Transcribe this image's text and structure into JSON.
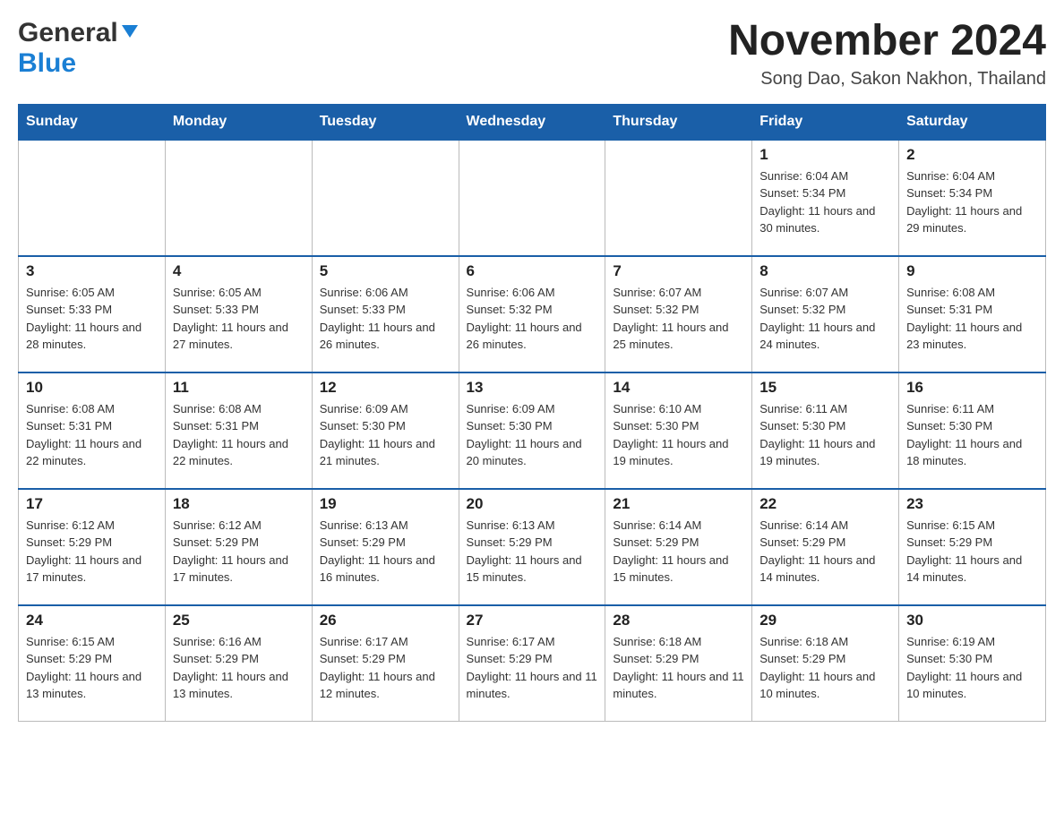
{
  "header": {
    "logo": {
      "general": "General",
      "blue": "Blue",
      "arrow": "▶"
    },
    "title": "November 2024",
    "subtitle": "Song Dao, Sakon Nakhon, Thailand"
  },
  "days_of_week": [
    "Sunday",
    "Monday",
    "Tuesday",
    "Wednesday",
    "Thursday",
    "Friday",
    "Saturday"
  ],
  "weeks": [
    [
      {
        "day": "",
        "info": ""
      },
      {
        "day": "",
        "info": ""
      },
      {
        "day": "",
        "info": ""
      },
      {
        "day": "",
        "info": ""
      },
      {
        "day": "",
        "info": ""
      },
      {
        "day": "1",
        "info": "Sunrise: 6:04 AM\nSunset: 5:34 PM\nDaylight: 11 hours and 30 minutes."
      },
      {
        "day": "2",
        "info": "Sunrise: 6:04 AM\nSunset: 5:34 PM\nDaylight: 11 hours and 29 minutes."
      }
    ],
    [
      {
        "day": "3",
        "info": "Sunrise: 6:05 AM\nSunset: 5:33 PM\nDaylight: 11 hours and 28 minutes."
      },
      {
        "day": "4",
        "info": "Sunrise: 6:05 AM\nSunset: 5:33 PM\nDaylight: 11 hours and 27 minutes."
      },
      {
        "day": "5",
        "info": "Sunrise: 6:06 AM\nSunset: 5:33 PM\nDaylight: 11 hours and 26 minutes."
      },
      {
        "day": "6",
        "info": "Sunrise: 6:06 AM\nSunset: 5:32 PM\nDaylight: 11 hours and 26 minutes."
      },
      {
        "day": "7",
        "info": "Sunrise: 6:07 AM\nSunset: 5:32 PM\nDaylight: 11 hours and 25 minutes."
      },
      {
        "day": "8",
        "info": "Sunrise: 6:07 AM\nSunset: 5:32 PM\nDaylight: 11 hours and 24 minutes."
      },
      {
        "day": "9",
        "info": "Sunrise: 6:08 AM\nSunset: 5:31 PM\nDaylight: 11 hours and 23 minutes."
      }
    ],
    [
      {
        "day": "10",
        "info": "Sunrise: 6:08 AM\nSunset: 5:31 PM\nDaylight: 11 hours and 22 minutes."
      },
      {
        "day": "11",
        "info": "Sunrise: 6:08 AM\nSunset: 5:31 PM\nDaylight: 11 hours and 22 minutes."
      },
      {
        "day": "12",
        "info": "Sunrise: 6:09 AM\nSunset: 5:30 PM\nDaylight: 11 hours and 21 minutes."
      },
      {
        "day": "13",
        "info": "Sunrise: 6:09 AM\nSunset: 5:30 PM\nDaylight: 11 hours and 20 minutes."
      },
      {
        "day": "14",
        "info": "Sunrise: 6:10 AM\nSunset: 5:30 PM\nDaylight: 11 hours and 19 minutes."
      },
      {
        "day": "15",
        "info": "Sunrise: 6:11 AM\nSunset: 5:30 PM\nDaylight: 11 hours and 19 minutes."
      },
      {
        "day": "16",
        "info": "Sunrise: 6:11 AM\nSunset: 5:30 PM\nDaylight: 11 hours and 18 minutes."
      }
    ],
    [
      {
        "day": "17",
        "info": "Sunrise: 6:12 AM\nSunset: 5:29 PM\nDaylight: 11 hours and 17 minutes."
      },
      {
        "day": "18",
        "info": "Sunrise: 6:12 AM\nSunset: 5:29 PM\nDaylight: 11 hours and 17 minutes."
      },
      {
        "day": "19",
        "info": "Sunrise: 6:13 AM\nSunset: 5:29 PM\nDaylight: 11 hours and 16 minutes."
      },
      {
        "day": "20",
        "info": "Sunrise: 6:13 AM\nSunset: 5:29 PM\nDaylight: 11 hours and 15 minutes."
      },
      {
        "day": "21",
        "info": "Sunrise: 6:14 AM\nSunset: 5:29 PM\nDaylight: 11 hours and 15 minutes."
      },
      {
        "day": "22",
        "info": "Sunrise: 6:14 AM\nSunset: 5:29 PM\nDaylight: 11 hours and 14 minutes."
      },
      {
        "day": "23",
        "info": "Sunrise: 6:15 AM\nSunset: 5:29 PM\nDaylight: 11 hours and 14 minutes."
      }
    ],
    [
      {
        "day": "24",
        "info": "Sunrise: 6:15 AM\nSunset: 5:29 PM\nDaylight: 11 hours and 13 minutes."
      },
      {
        "day": "25",
        "info": "Sunrise: 6:16 AM\nSunset: 5:29 PM\nDaylight: 11 hours and 13 minutes."
      },
      {
        "day": "26",
        "info": "Sunrise: 6:17 AM\nSunset: 5:29 PM\nDaylight: 11 hours and 12 minutes."
      },
      {
        "day": "27",
        "info": "Sunrise: 6:17 AM\nSunset: 5:29 PM\nDaylight: 11 hours and 11 minutes."
      },
      {
        "day": "28",
        "info": "Sunrise: 6:18 AM\nSunset: 5:29 PM\nDaylight: 11 hours and 11 minutes."
      },
      {
        "day": "29",
        "info": "Sunrise: 6:18 AM\nSunset: 5:29 PM\nDaylight: 11 hours and 10 minutes."
      },
      {
        "day": "30",
        "info": "Sunrise: 6:19 AM\nSunset: 5:30 PM\nDaylight: 11 hours and 10 minutes."
      }
    ]
  ]
}
